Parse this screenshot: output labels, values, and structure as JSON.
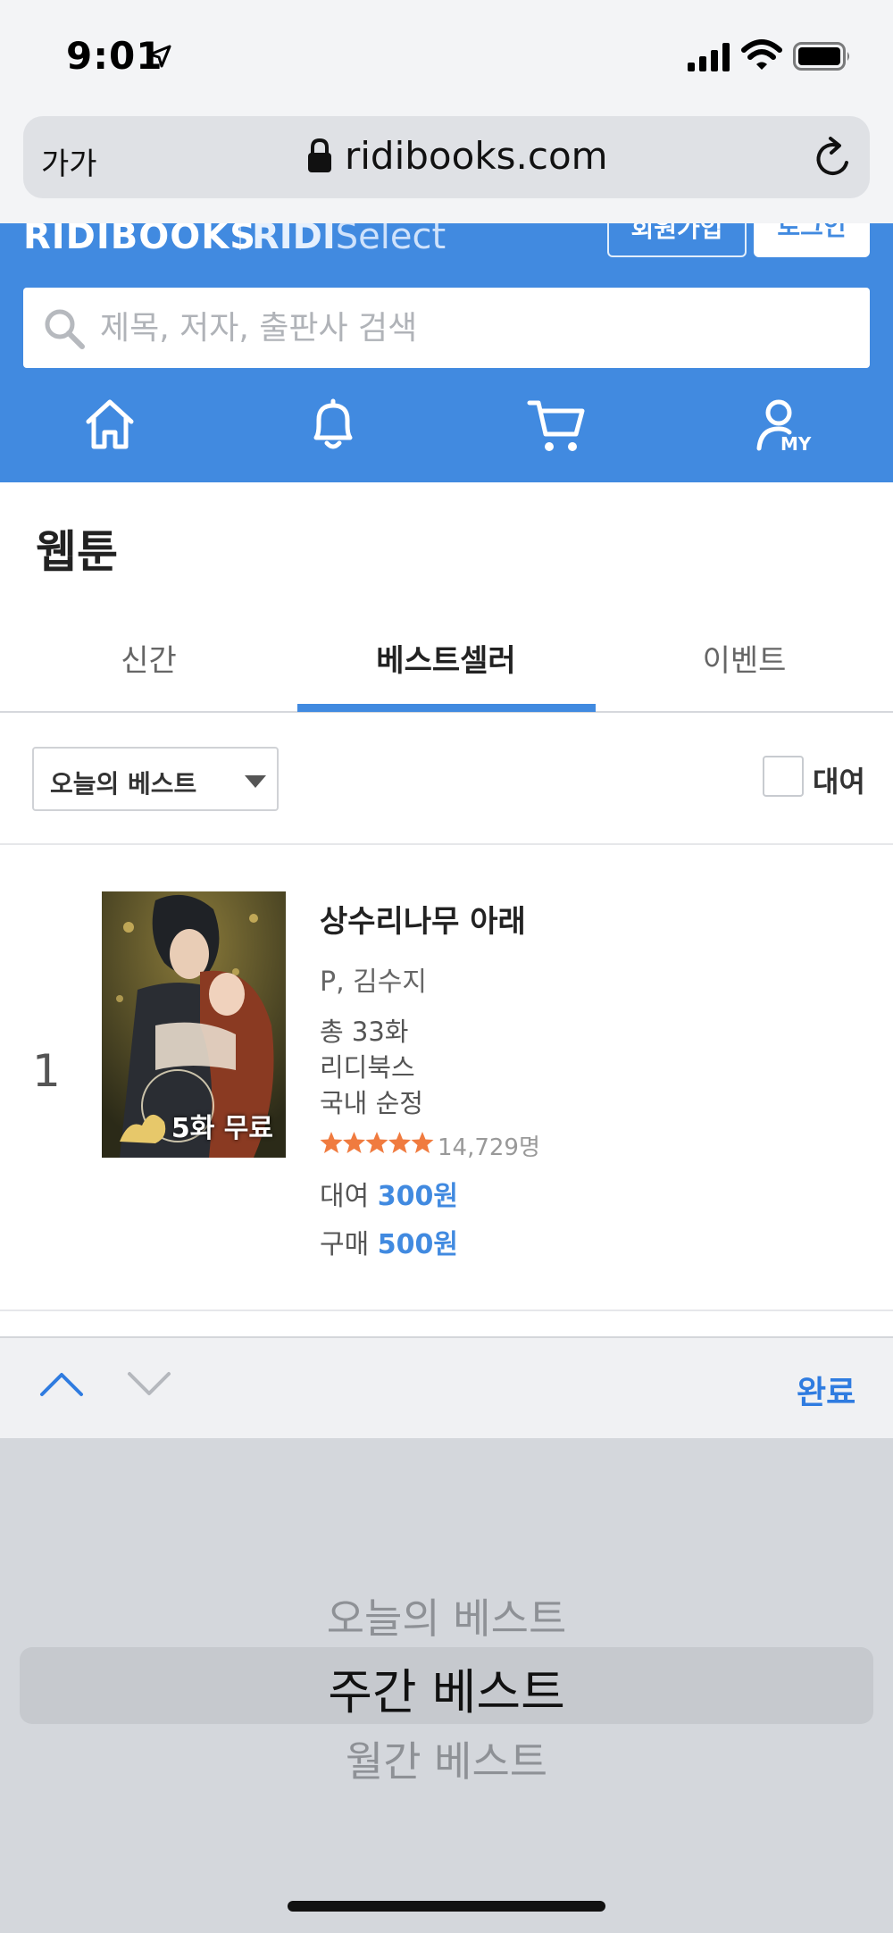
{
  "status_bar": {
    "time": "9:01"
  },
  "browser": {
    "text_size_label": "가가",
    "url": "ridibooks.com"
  },
  "header": {
    "logo": "RIDIBOOKS",
    "select_logo_bold": "RIDI",
    "select_logo_light": "Select",
    "signup_label": "회원가입",
    "login_label": "로그인",
    "search_placeholder": "제목, 저자, 출판사 검색",
    "nav": [
      "home-icon",
      "bell-icon",
      "cart-icon",
      "my-account-icon"
    ],
    "my_label": "MY"
  },
  "page": {
    "title": "웹툰",
    "tabs": [
      {
        "label": "신간",
        "active": false
      },
      {
        "label": "베스트셀러",
        "active": true
      },
      {
        "label": "이벤트",
        "active": false
      }
    ],
    "filter": {
      "selected": "오늘의 베스트",
      "rent_label": "대여",
      "rent_checked": false
    }
  },
  "books": [
    {
      "rank": "1",
      "cover_badge": "5화 무료",
      "title": "상수리나무 아래",
      "author": "P, 김수지",
      "episodes": "총 33화",
      "publisher": "리디북스",
      "genre": "국내 순정",
      "rating_stars": 5,
      "review_count": "14,729명",
      "rent_prefix": "대여",
      "rent_price": "300원",
      "buy_prefix": "구매",
      "buy_price": "500원"
    }
  ],
  "picker": {
    "done_label": "완료",
    "options": [
      "오늘의 베스트",
      "주간 베스트",
      "월간 베스트"
    ],
    "selected": "주간 베스트"
  },
  "colors": {
    "brand_blue": "#418ae0",
    "star_orange": "#f07b3f"
  }
}
